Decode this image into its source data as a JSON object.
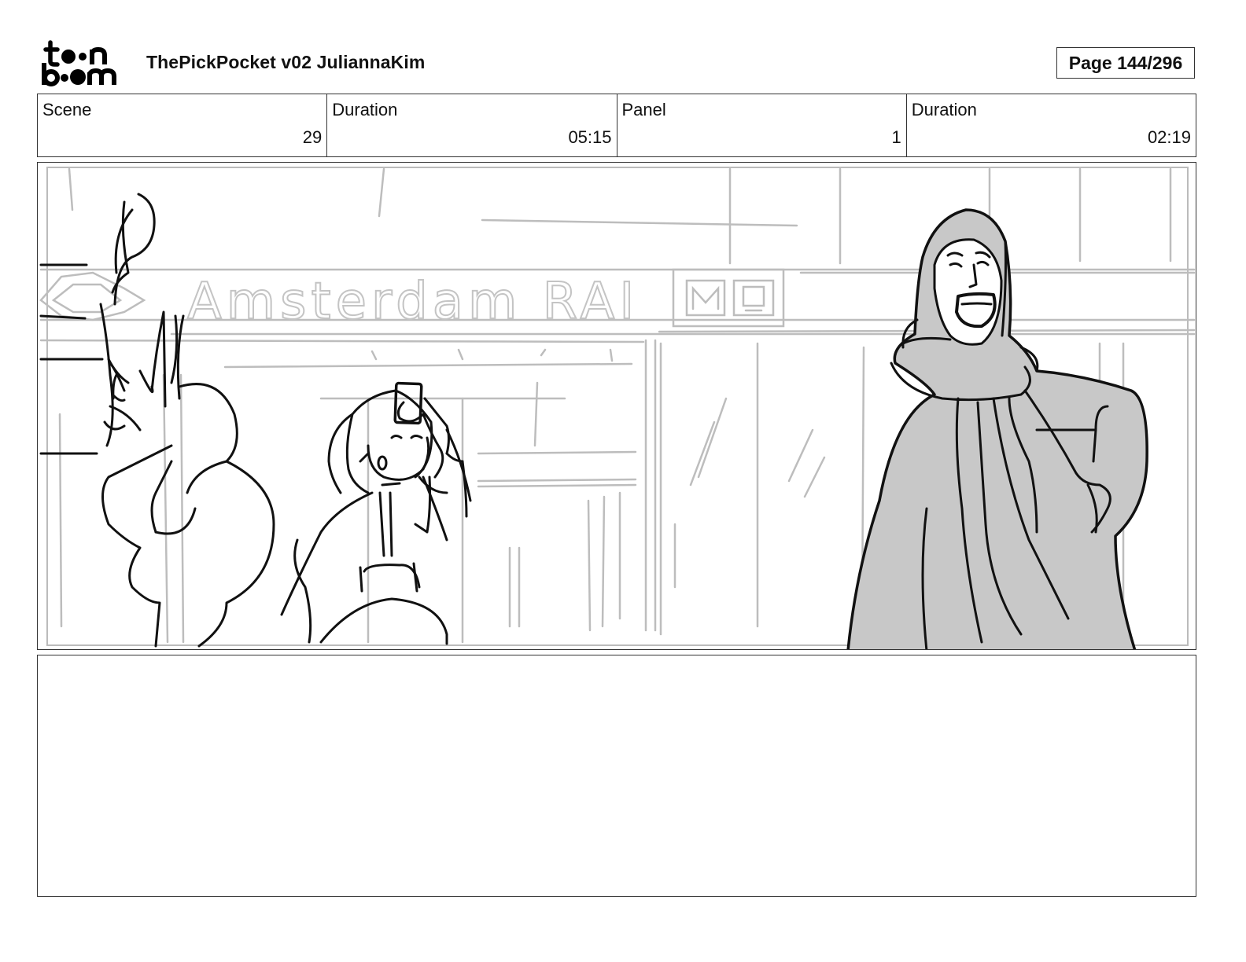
{
  "header": {
    "logo_name": "toon boom",
    "title": "ThePickPocket v02 JuliannaKim",
    "page": "Page 144/296"
  },
  "info": {
    "scene_label": "Scene",
    "scene_value": "29",
    "scene_duration_label": "Duration",
    "scene_duration_value": "05:15",
    "panel_label": "Panel",
    "panel_value": "1",
    "panel_duration_label": "Duration",
    "panel_duration_value": "02:19"
  },
  "panel": {
    "sign_text": "Amsterdam RAI"
  },
  "notes": {
    "text": ""
  }
}
